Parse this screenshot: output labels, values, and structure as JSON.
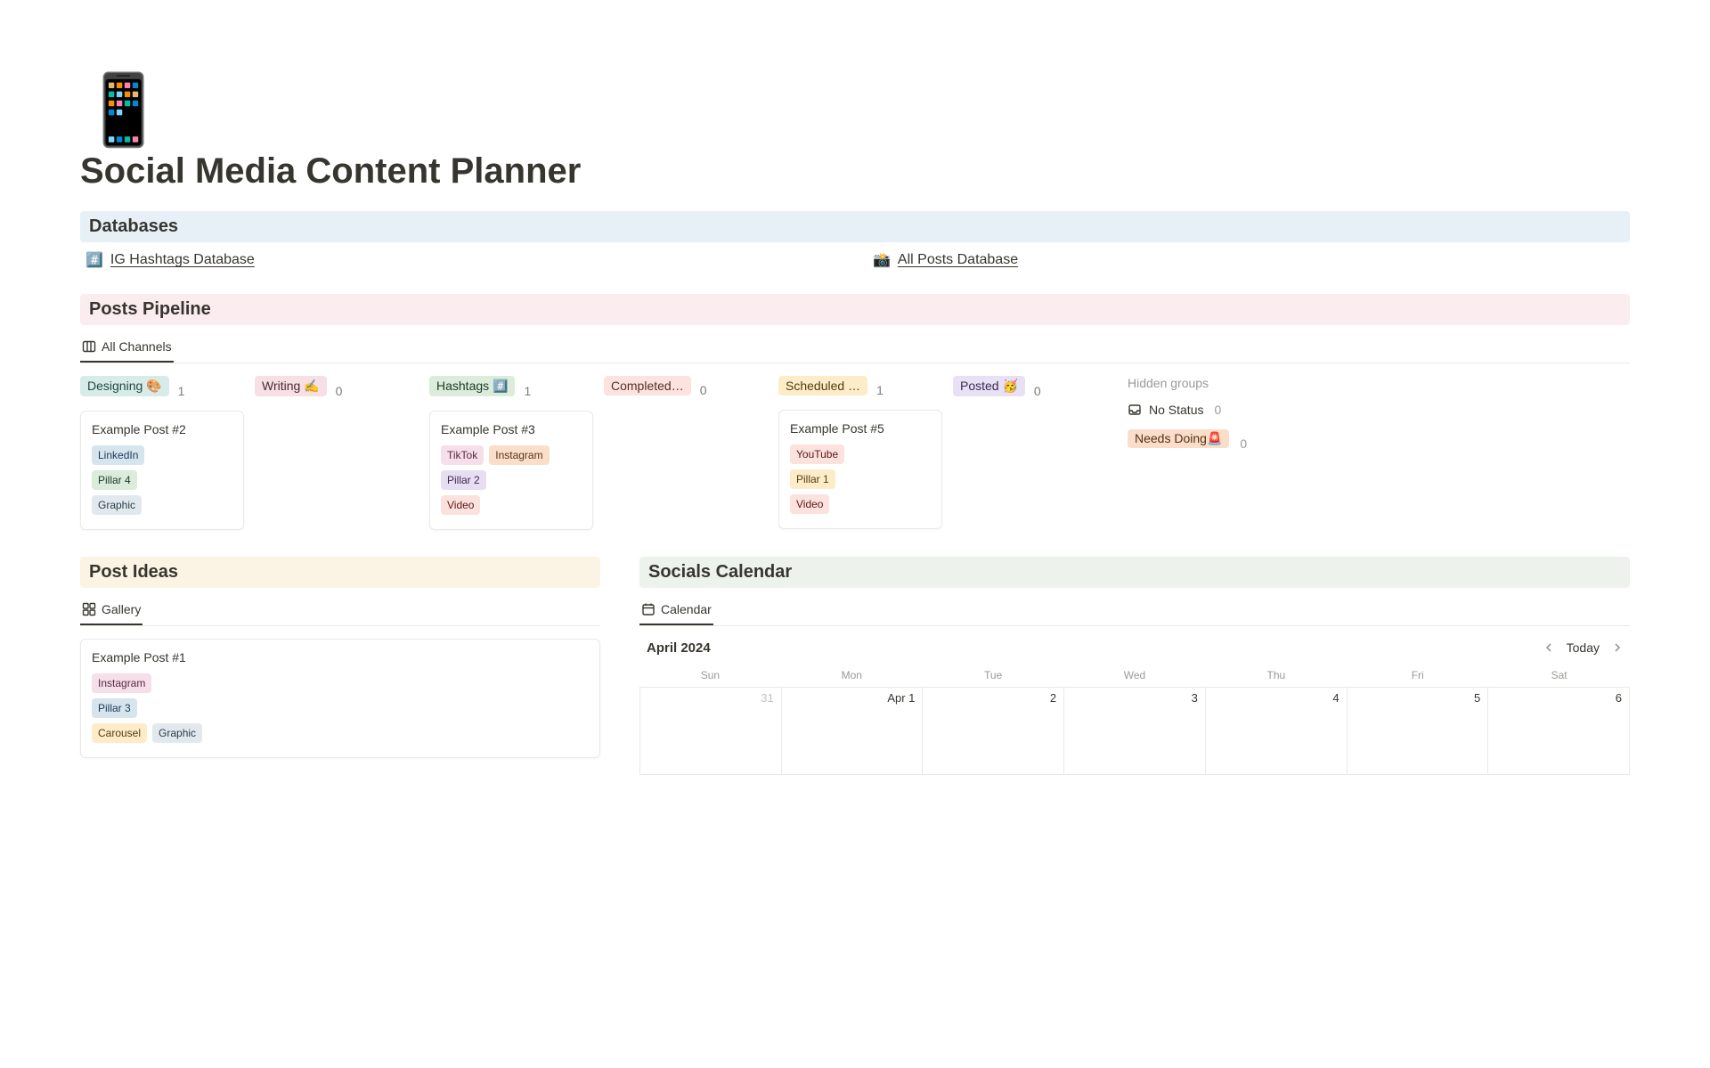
{
  "page": {
    "icon": "📱",
    "title": "Social Media Content Planner"
  },
  "sections": {
    "databases": {
      "title": "Databases"
    },
    "pipeline": {
      "title": "Posts Pipeline"
    },
    "ideas": {
      "title": "Post Ideas"
    },
    "calendar": {
      "title": "Socials Calendar"
    }
  },
  "databases": [
    {
      "icon": "#️⃣",
      "label": "IG Hashtags Database"
    },
    {
      "icon": "📸",
      "label": "All Posts Database"
    }
  ],
  "pipeline": {
    "tab_label": "All Channels",
    "columns": [
      {
        "label": "Designing 🎨",
        "count": 1,
        "hclass": "bg-teal",
        "card": {
          "title": "Example Post #2",
          "rows": [
            [
              {
                "text": "LinkedIn",
                "cls": "t-blue"
              }
            ],
            [
              {
                "text": "Pillar 4",
                "cls": "t-green"
              }
            ],
            [
              {
                "text": "Graphic",
                "cls": "t-grayblue"
              }
            ]
          ]
        }
      },
      {
        "label": "Writing ✍️",
        "count": 0,
        "hclass": "bg-rose",
        "card": null
      },
      {
        "label": "Hashtags #️⃣",
        "count": 1,
        "hclass": "bg-lime",
        "card": {
          "title": "Example Post #3",
          "rows": [
            [
              {
                "text": "TikTok",
                "cls": "t-pink"
              },
              {
                "text": "Instagram",
                "cls": "t-orange"
              }
            ],
            [
              {
                "text": "Pillar 2",
                "cls": "t-purple"
              }
            ],
            [
              {
                "text": "Video",
                "cls": "t-red"
              }
            ]
          ]
        }
      },
      {
        "label": "Completed…",
        "count": 0,
        "hclass": "bg-salmon",
        "card": null
      },
      {
        "label": "Scheduled …",
        "count": 1,
        "hclass": "bg-amber",
        "card": {
          "title": "Example Post #5",
          "rows": [
            [
              {
                "text": "YouTube",
                "cls": "t-red"
              }
            ],
            [
              {
                "text": "Pillar 1",
                "cls": "t-yellow"
              }
            ],
            [
              {
                "text": "Video",
                "cls": "t-red"
              }
            ]
          ]
        }
      },
      {
        "label": "Posted 🥳",
        "count": 0,
        "hclass": "bg-lilac",
        "card": null
      }
    ],
    "hidden": {
      "title": "Hidden groups",
      "items": [
        {
          "icon": "inbox",
          "label": "No Status",
          "count": 0
        },
        {
          "icon": "pill",
          "label": "Needs Doing🚨",
          "count": 0,
          "cls": "bg-peach"
        }
      ]
    }
  },
  "ideas": {
    "tab_label": "Gallery",
    "card": {
      "title": "Example Post #1",
      "rows": [
        [
          {
            "text": "Instagram",
            "cls": "t-pink"
          }
        ],
        [
          {
            "text": "Pillar 3",
            "cls": "t-blue"
          }
        ],
        [
          {
            "text": "Carousel",
            "cls": "t-yellow"
          },
          {
            "text": "Graphic",
            "cls": "t-grayblue"
          }
        ]
      ]
    }
  },
  "calendar": {
    "tab_label": "Calendar",
    "month": "April 2024",
    "today_label": "Today",
    "dow": [
      "Sun",
      "Mon",
      "Tue",
      "Wed",
      "Thu",
      "Fri",
      "Sat"
    ],
    "cells": [
      {
        "d": "31",
        "other": true
      },
      {
        "d": "Apr 1"
      },
      {
        "d": "2"
      },
      {
        "d": "3"
      },
      {
        "d": "4"
      },
      {
        "d": "5"
      },
      {
        "d": "6"
      }
    ]
  }
}
